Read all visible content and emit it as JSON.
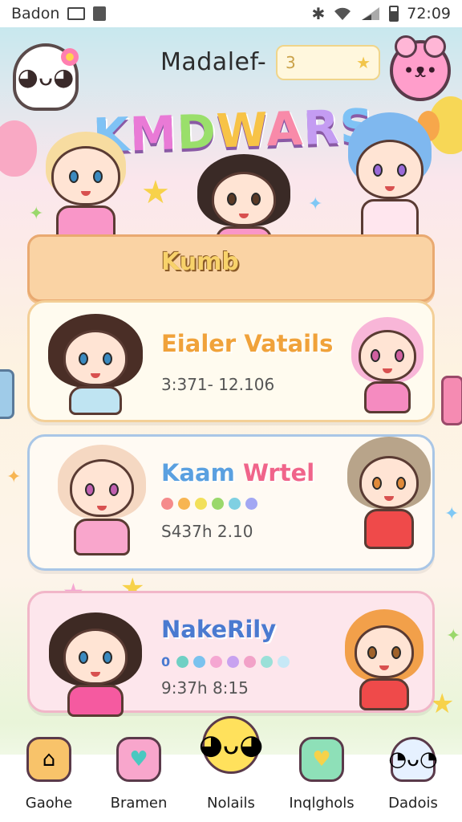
{
  "status_bar": {
    "carrier": "Badon",
    "time": "72:09",
    "icons": [
      "box-icon",
      "bag-icon",
      "bluetooth-icon",
      "wifi-icon",
      "signal-icon",
      "battery-icon"
    ]
  },
  "header": {
    "title": "Madalef-",
    "input_value": "3",
    "logo": "KMDWARS"
  },
  "banner": {
    "label": "Kumb"
  },
  "cards": [
    {
      "title": "Eialer Vatails",
      "meta": "3:371- 12.106",
      "title_color": "#f0a23a"
    },
    {
      "title_part1": "Kaam",
      "title_part2": "Wrtel",
      "meta": "S437h 2.10",
      "dot_colors": [
        "#f58b8b",
        "#f7b552",
        "#f2e05a",
        "#9ad86b",
        "#7fd0e2",
        "#a2a7f3"
      ]
    },
    {
      "title": "NakeRily",
      "dots_prefix": "0",
      "meta": "9:37h 8:15",
      "dot_colors": [
        "#6fd0c4",
        "#7ac2ee",
        "#f5a7d2",
        "#c8a2f0",
        "#f2a2c8",
        "#9ae0d8",
        "#c6e8f6"
      ]
    }
  ],
  "bottom_nav": [
    {
      "label": "Gaohe",
      "icon": "house-icon"
    },
    {
      "label": "Bramen",
      "icon": "heart-icon"
    },
    {
      "label": "Nolails",
      "icon": "chick-icon"
    },
    {
      "label": "Inqlghols",
      "icon": "chat-heart-icon"
    },
    {
      "label": "Dadois",
      "icon": "ghost-icon"
    }
  ],
  "colors": {
    "banner": "#fad3a4",
    "card1_border": "#f3cf97",
    "card2_border": "#a9c6e6",
    "card3_border": "#f1b6c8"
  }
}
